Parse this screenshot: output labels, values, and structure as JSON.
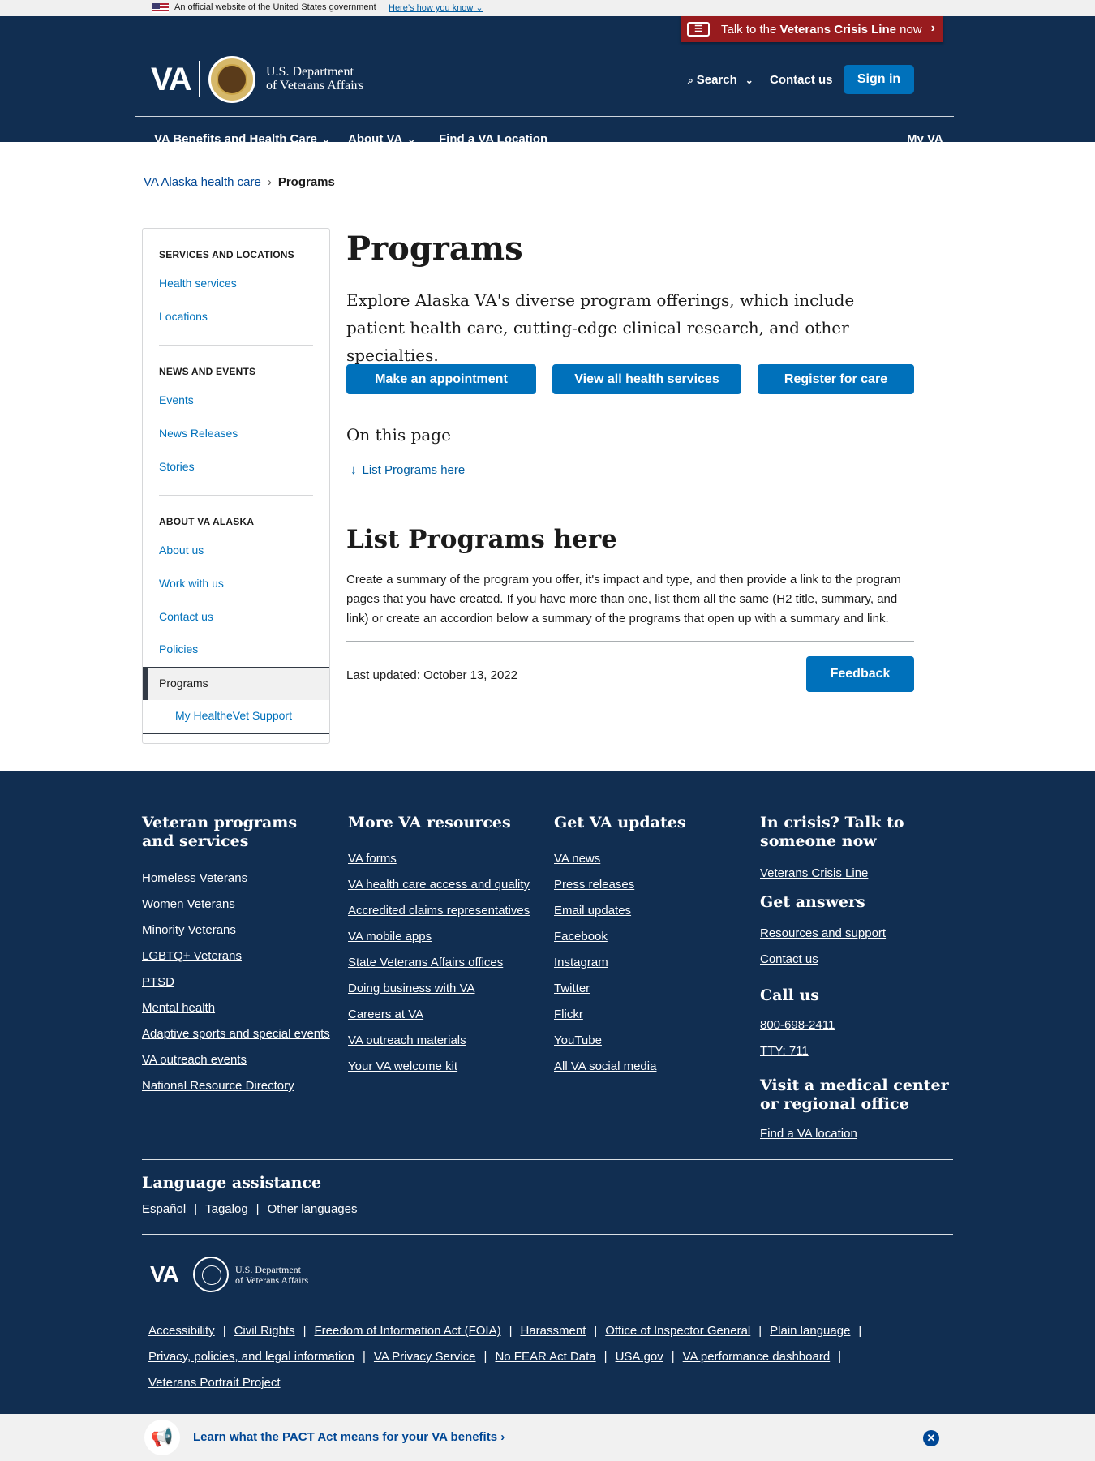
{
  "banner": {
    "official_text": "An official website of the United States government",
    "how_know": "Here’s how you know"
  },
  "crisis": {
    "prefix": "Talk to the ",
    "bold": "Veterans Crisis Line",
    "suffix": " now"
  },
  "header": {
    "logo": "VA",
    "dept_line1": "U.S. Department",
    "dept_line2": "of Veterans Affairs",
    "search": "Search",
    "contact": "Contact us",
    "signin": "Sign in"
  },
  "nav": {
    "items": [
      "VA Benefits and Health Care",
      "About VA",
      "Find a VA Location"
    ],
    "myva": "My VA"
  },
  "breadcrumb": {
    "parent": "VA Alaska health care",
    "current": "Programs"
  },
  "sidebar": {
    "sections": [
      {
        "heading": "Services and locations",
        "links": [
          "Health services",
          "Locations"
        ]
      },
      {
        "heading": "News and events",
        "links": [
          "Events",
          "News Releases",
          "Stories"
        ]
      },
      {
        "heading": "About VA Alaska",
        "links": [
          "About us",
          "Work with us",
          "Contact us",
          "Policies"
        ]
      }
    ],
    "active": "Programs",
    "sub": "My HealtheVet Support"
  },
  "main": {
    "title": "Programs",
    "intro": "Explore Alaska VA's diverse program offerings, which include patient health care, cutting-edge clinical research, and other specialties.",
    "buttons": [
      "Make an appointment",
      "View all health services",
      "Register for care"
    ],
    "on_this_page": "On this page",
    "toc_link": "List Programs here",
    "section_title": "List Programs here",
    "section_body": "Create a summary of the program you offer, it's impact and type, and then provide a link to the program pages that you have created.  If you have more than one, list them all the same (H2 title, summary, and link) or create an accordion below a summary of the programs that open up with a summary and link.",
    "last_updated": "Last updated: October 13, 2022",
    "feedback": "Feedback"
  },
  "footer": {
    "col1": {
      "title": "Veteran programs and services",
      "links": [
        "Homeless Veterans",
        "Women Veterans",
        "Minority Veterans",
        "LGBTQ+ Veterans",
        "PTSD",
        "Mental health",
        "Adaptive sports and special events",
        "VA outreach events",
        "National Resource Directory"
      ]
    },
    "col2": {
      "title": "More VA resources",
      "links": [
        "VA forms",
        "VA health care access and quality",
        "Accredited claims representatives",
        "VA mobile apps",
        "State Veterans Affairs offices",
        "Doing business with VA",
        "Careers at VA",
        "VA outreach materials",
        "Your VA welcome kit"
      ]
    },
    "col3": {
      "title": "Get VA updates",
      "links": [
        "VA news",
        "Press releases",
        "Email updates",
        "Facebook",
        "Instagram",
        "Twitter",
        "Flickr",
        "YouTube",
        "All VA social media"
      ]
    },
    "col4": {
      "crisis_title": "In crisis? Talk to someone now",
      "crisis_link": "Veterans Crisis Line",
      "answers_title": "Get answers",
      "answers_links": [
        "Resources and support",
        "Contact us"
      ],
      "call_title": "Call us",
      "phone": "800-698-2411",
      "tty": "TTY: 711",
      "visit_title": "Visit a medical center or regional office",
      "visit_link": "Find a VA location"
    },
    "language": {
      "title": "Language assistance",
      "links": [
        "Español",
        "Tagalog",
        "Other languages"
      ]
    },
    "logo": "VA",
    "dept_line1": "U.S. Department",
    "dept_line2": "of Veterans Affairs",
    "bottom_row1": [
      "Accessibility",
      "Civil Rights",
      "Freedom of Information Act (FOIA)",
      "Harassment",
      "Office of Inspector General",
      "Plain language"
    ],
    "bottom_row2": [
      "Privacy, policies, and legal information",
      "VA Privacy Service",
      "No FEAR Act Data",
      "USA.gov",
      "VA performance dashboard"
    ],
    "bottom_row3": [
      "Veterans Portrait Project"
    ]
  },
  "pact": {
    "text": "Learn what the PACT Act means for your VA benefits",
    "close_icon": "close-icon"
  }
}
